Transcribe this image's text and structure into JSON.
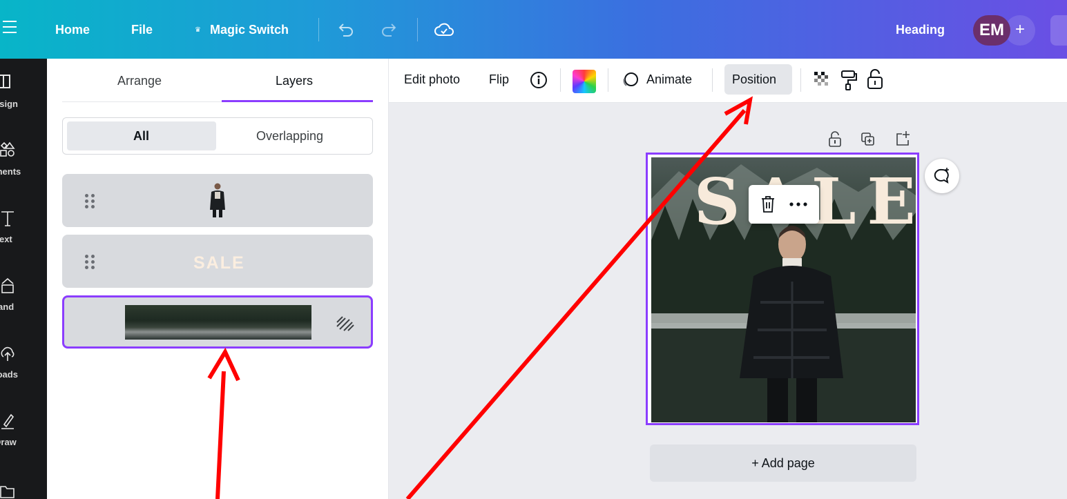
{
  "topbar": {
    "home": "Home",
    "file": "File",
    "magic_switch": "Magic Switch",
    "heading": "Heading",
    "avatar_initials": "EM",
    "avatar_plus": "+"
  },
  "rail": {
    "items": [
      {
        "label": "esign",
        "icon": "layout-icon"
      },
      {
        "label": "ments",
        "icon": "elements-icon"
      },
      {
        "label": "Text",
        "icon": "text-icon"
      },
      {
        "label": "rand",
        "icon": "brand-icon"
      },
      {
        "label": "loads",
        "icon": "upload-icon"
      },
      {
        "label": "Draw",
        "icon": "draw-icon"
      }
    ]
  },
  "panel": {
    "tabs": [
      {
        "label": "Arrange"
      },
      {
        "label": "Layers"
      }
    ],
    "active_tab": "Layers",
    "filters": [
      {
        "label": "All"
      },
      {
        "label": "Overlapping"
      }
    ],
    "active_filter": "All",
    "layers": [
      {
        "type": "image",
        "content": "man-photo"
      },
      {
        "type": "text",
        "content": "SALE"
      },
      {
        "type": "background",
        "content": "forest-photo",
        "selected": true
      }
    ]
  },
  "toolbar": {
    "edit_photo": "Edit photo",
    "flip": "Flip",
    "animate": "Animate",
    "position": "Position"
  },
  "canvas": {
    "sale_text": "SALE",
    "add_page": "+ Add page"
  },
  "colors": {
    "accent": "#8b3dff",
    "annotation_arrow": "#ff0000"
  }
}
